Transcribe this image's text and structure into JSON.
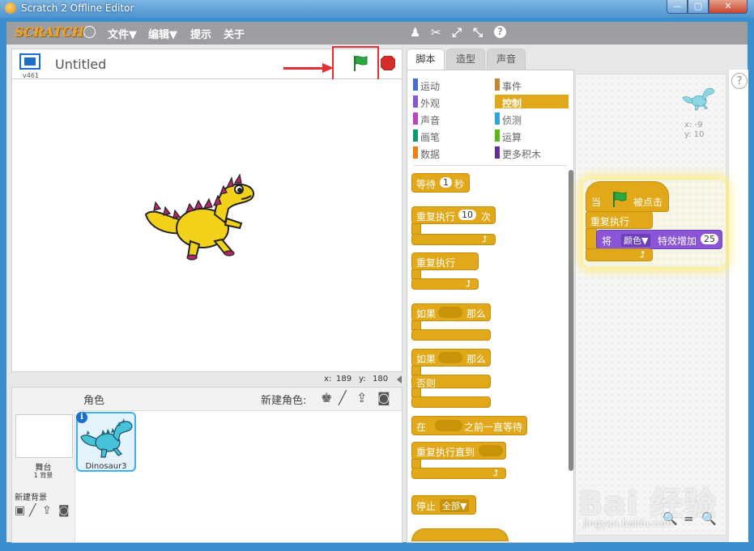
{
  "window": {
    "title": "Scratch 2 Offline Editor",
    "min": "—",
    "max": "▢",
    "close": "✕"
  },
  "menubar": {
    "logo": "SCRATCH",
    "items": [
      "文件▼",
      "编辑▼",
      "提示",
      "关于"
    ],
    "tools": [
      "duplicate-icon",
      "cut-icon",
      "grow-icon",
      "shrink-icon",
      "help-icon"
    ],
    "tool_glyphs": [
      "♟",
      "✂",
      "⤢",
      "⤡",
      "?"
    ]
  },
  "stage": {
    "project_title": "Untitled",
    "version": "v461",
    "mouse_x_label": "x:",
    "mouse_x": "189",
    "mouse_y_label": "y:",
    "mouse_y": "180"
  },
  "sprites_pane": {
    "header": "角色",
    "new_sprite_label": "新建角色:",
    "stage_label": "舞台",
    "backdrop_count": "1 背景",
    "new_backdrop_label": "新建背景",
    "sprite_name": "Dinosaur3",
    "info_glyph": "i",
    "new_sprite_icons": [
      "♚",
      "╱",
      "⇪",
      "◙"
    ],
    "new_backdrop_icons": [
      "▣",
      "╱",
      "⇪",
      "◙"
    ]
  },
  "tabs": [
    "脚本",
    "造型",
    "声音"
  ],
  "categories": {
    "left": [
      {
        "label": "运动",
        "color": "#4a6cd4"
      },
      {
        "label": "外观",
        "color": "#8a55d7"
      },
      {
        "label": "声音",
        "color": "#bb42c3"
      },
      {
        "label": "画笔",
        "color": "#0e9a6c"
      },
      {
        "label": "数据",
        "color": "#ee7d16"
      }
    ],
    "right": [
      {
        "label": "事件",
        "color": "#c88330"
      },
      {
        "label": "控制",
        "color": "#e1a91a",
        "selected": true
      },
      {
        "label": "侦测",
        "color": "#2ca5e2"
      },
      {
        "label": "运算",
        "color": "#5cb712"
      },
      {
        "label": "更多积木",
        "color": "#632d99"
      }
    ]
  },
  "palette_blocks": {
    "wait": {
      "label": "等待",
      "value": "1",
      "unit": "秒"
    },
    "repeat": {
      "label": "重复执行",
      "value": "10",
      "unit": "次"
    },
    "forever": {
      "label": "重复执行"
    },
    "if_then": {
      "label": "如果",
      "then": "那么"
    },
    "if_else": {
      "label": "如果",
      "then": "那么",
      "else": "否则"
    },
    "wait_until": {
      "label": "在",
      "suffix": "之前一直等待"
    },
    "repeat_until": {
      "label": "重复执行直到"
    },
    "stop": {
      "label": "停止",
      "option": "全部▼"
    },
    "loop_arrow": "⮥"
  },
  "scripts": {
    "sprite_x": "x: -9",
    "sprite_y": "y: 10",
    "hat": {
      "prefix": "当",
      "suffix": "被点击"
    },
    "forever": "重复执行",
    "effect": {
      "label": "将",
      "option": "颜色▼",
      "suffix": "特效增加",
      "value": "25"
    },
    "zoom_out": "🔍",
    "zoom_reset": "=",
    "zoom_in": "🔍",
    "help": "?"
  },
  "watermark": {
    "text": "Bai 经验",
    "url": "jingyan.baidu.com"
  },
  "colors": {
    "control": "#e1a91a",
    "looks": "#8a55d7",
    "flag": "#2bab3f",
    "stop": "#d62c2c",
    "highlight_box": "#e03030"
  }
}
